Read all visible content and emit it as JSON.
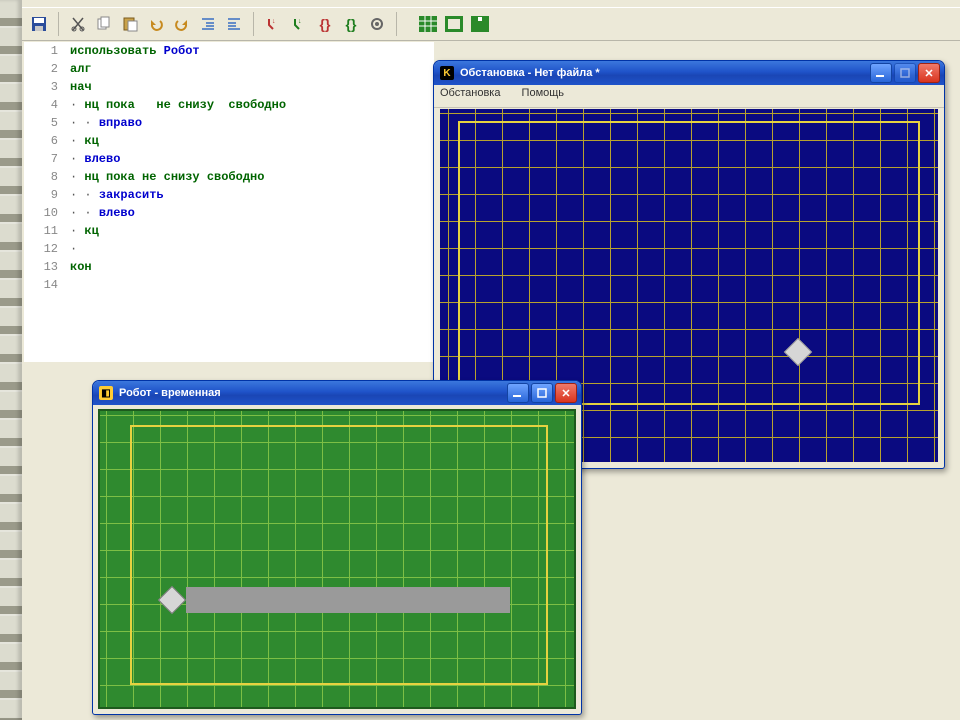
{
  "toolbar_icons": [
    "save-icon",
    "cut-icon",
    "copy-icon",
    "paste-icon",
    "undo-icon",
    "redo-icon",
    "indent-icon",
    "outdent-icon",
    "step-into-icon",
    "step-over-icon",
    "brace-open-icon",
    "brace-close-icon",
    "gear-icon",
    "grid-icon",
    "grid-dense-icon",
    "outline-icon",
    "robot-icon"
  ],
  "code_lines": [
    {
      "n": 1,
      "segments": [
        {
          "t": "использовать ",
          "c": "kw"
        },
        {
          "t": "Робот",
          "c": "id"
        }
      ]
    },
    {
      "n": 2,
      "segments": [
        {
          "t": "алг",
          "c": "kw"
        }
      ]
    },
    {
      "n": 3,
      "segments": [
        {
          "t": "нач",
          "c": "kw"
        }
      ]
    },
    {
      "n": 4,
      "segments": [
        {
          "t": "· ",
          "c": "dot"
        },
        {
          "t": "нц пока   не снизу  свободно",
          "c": "kw"
        }
      ]
    },
    {
      "n": 5,
      "segments": [
        {
          "t": "· · ",
          "c": "dot"
        },
        {
          "t": "вправо",
          "c": "id"
        }
      ]
    },
    {
      "n": 6,
      "segments": [
        {
          "t": "· ",
          "c": "dot"
        },
        {
          "t": "кц",
          "c": "kw"
        }
      ]
    },
    {
      "n": 7,
      "segments": [
        {
          "t": "· ",
          "c": "dot"
        },
        {
          "t": "влево",
          "c": "id"
        }
      ]
    },
    {
      "n": 8,
      "segments": [
        {
          "t": "· ",
          "c": "dot"
        },
        {
          "t": "нц пока не снизу свободно",
          "c": "kw"
        }
      ]
    },
    {
      "n": 9,
      "segments": [
        {
          "t": "· · ",
          "c": "dot"
        },
        {
          "t": "закрасить",
          "c": "id"
        }
      ]
    },
    {
      "n": 10,
      "segments": [
        {
          "t": "· · ",
          "c": "dot"
        },
        {
          "t": "влево",
          "c": "id"
        }
      ]
    },
    {
      "n": 11,
      "segments": [
        {
          "t": "· ",
          "c": "dot"
        },
        {
          "t": "кц",
          "c": "kw"
        }
      ]
    },
    {
      "n": 12,
      "segments": [
        {
          "t": "·",
          "c": "dot"
        }
      ]
    },
    {
      "n": 13,
      "segments": [
        {
          "t": "кон",
          "c": "kw"
        }
      ]
    },
    {
      "n": 14,
      "segments": []
    }
  ],
  "env_window": {
    "title": "Обстановка - Нет файла *",
    "menu": [
      "Обстановка",
      "Помощь"
    ]
  },
  "robot_window": {
    "title": "Робот - временная"
  }
}
